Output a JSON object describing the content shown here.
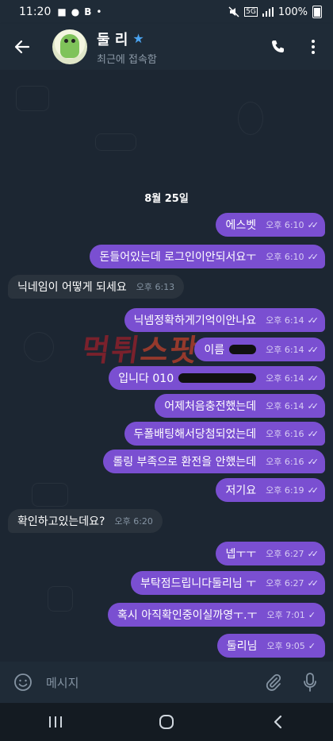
{
  "status_bar": {
    "time": "11:20",
    "left_glyphs": [
      "■",
      "●",
      "B",
      "•"
    ],
    "network": "5G",
    "battery": "100%"
  },
  "header": {
    "contact_name": "둘 리",
    "verified_star": "★",
    "last_seen": "최근에 접속함"
  },
  "chat": {
    "date": "8월 25일",
    "watermark": {
      "main": "먹튀",
      "accent": "스팟"
    },
    "messages": [
      {
        "text": "에스벳",
        "time": "오후 6:10",
        "dir": "out",
        "read": true
      },
      {
        "text": "돈들어있는데 로그인이안되서요ㅜ",
        "time": "오후 6:10",
        "dir": "out",
        "read": true
      },
      {
        "text": "닉네임이 어떻게 되세요",
        "time": "오후 6:13",
        "dir": "in"
      },
      {
        "text": "닉넴정확하게기억이안나요",
        "time": "오후 6:14",
        "dir": "out",
        "read": true
      },
      {
        "text": "이름",
        "time": "오후 6:14",
        "dir": "out",
        "read": true
      },
      {
        "text": "입니다 010",
        "time": "오후 6:14",
        "dir": "out",
        "read": true
      },
      {
        "text": "어제처음충전했는데",
        "time": "오후 6:14",
        "dir": "out",
        "read": true
      },
      {
        "text": "두폴배팅해서당첨되었는데",
        "time": "오후 6:16",
        "dir": "out",
        "read": true
      },
      {
        "text": "롤링 부족으로 환전을 안했는데",
        "time": "오후 6:16",
        "dir": "out",
        "read": true
      },
      {
        "text": "저기요",
        "time": "오후 6:19",
        "dir": "out",
        "read": true
      },
      {
        "text": "확인하고있는데요?",
        "time": "오후 6:20",
        "dir": "in"
      },
      {
        "text": "넵ㅜㅜ",
        "time": "오후 6:27",
        "dir": "out",
        "read": true
      },
      {
        "text": "부탁점드립니다둘리님 ㅜ",
        "time": "오후 6:27",
        "dir": "out",
        "read": true
      },
      {
        "text": "혹시 아직확인중이실까영ㅜ.ㅜ",
        "time": "오후 7:01",
        "dir": "out",
        "read": false
      },
      {
        "text": "둘리님",
        "time": "오후 9:05",
        "dir": "out",
        "read": false
      }
    ]
  },
  "input": {
    "placeholder": "메시지"
  },
  "nav": {
    "recent": "|||",
    "home": "○",
    "back": "<"
  },
  "colors": {
    "accent": "#7a4fd1",
    "incoming": "#2a333d",
    "background": "#1c2632"
  }
}
